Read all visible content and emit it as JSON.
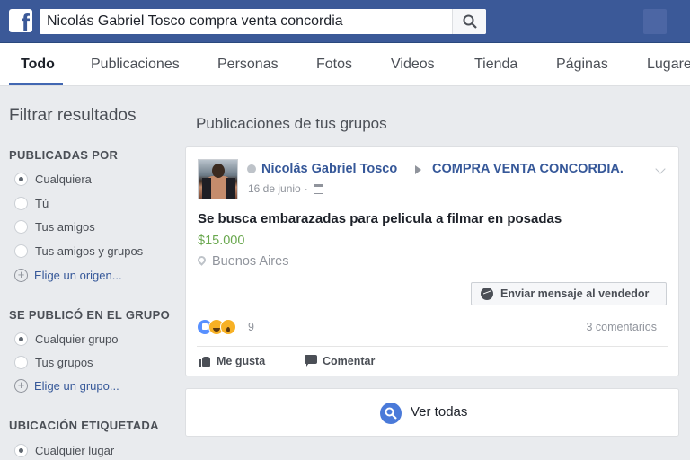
{
  "topbar": {
    "logo": "f",
    "search_value": "Nicolás Gabriel Tosco compra venta concordia",
    "search_icon": "search-icon"
  },
  "tabs": [
    {
      "label": "Todo",
      "active": true
    },
    {
      "label": "Publicaciones"
    },
    {
      "label": "Personas"
    },
    {
      "label": "Fotos"
    },
    {
      "label": "Videos"
    },
    {
      "label": "Tienda"
    },
    {
      "label": "Páginas"
    },
    {
      "label": "Lugares"
    }
  ],
  "filters": {
    "title": "Filtrar resultados",
    "published_by": {
      "heading": "PUBLICADAS POR",
      "options": [
        "Cualquiera",
        "Tú",
        "Tus amigos",
        "Tus amigos y grupos"
      ],
      "selected": "Cualquiera",
      "link": "Elige un origen..."
    },
    "published_in_group": {
      "heading": "SE PUBLICÓ EN EL GRUPO",
      "options": [
        "Cualquier grupo",
        "Tus grupos"
      ],
      "selected": "Cualquier grupo",
      "link": "Elige un grupo..."
    },
    "tagged_location": {
      "heading": "UBICACIÓN ETIQUETADA",
      "options": [
        "Cualquier lugar"
      ],
      "selected": "Cualquier lugar"
    }
  },
  "main": {
    "section_title": "Publicaciones de tus grupos",
    "post": {
      "author": "Nicolás Gabriel Tosco",
      "group": "COMPRA VENTA CONCORDIA.",
      "date": "16 de junio",
      "title": "Se busca embarazadas para pelicula a filmar en posadas",
      "price": "$15.000",
      "location": "Buenos Aires",
      "message_button": "Enviar mensaje al vendedor",
      "reaction_count": "9",
      "comments": "3 comentarios",
      "actions": {
        "like": "Me gusta",
        "comment": "Comentar"
      }
    },
    "see_all": "Ver todas"
  },
  "colors": {
    "brand": "#3b5998",
    "link": "#365899",
    "price": "#6aa84f",
    "tab_underline": "#4267b2"
  }
}
